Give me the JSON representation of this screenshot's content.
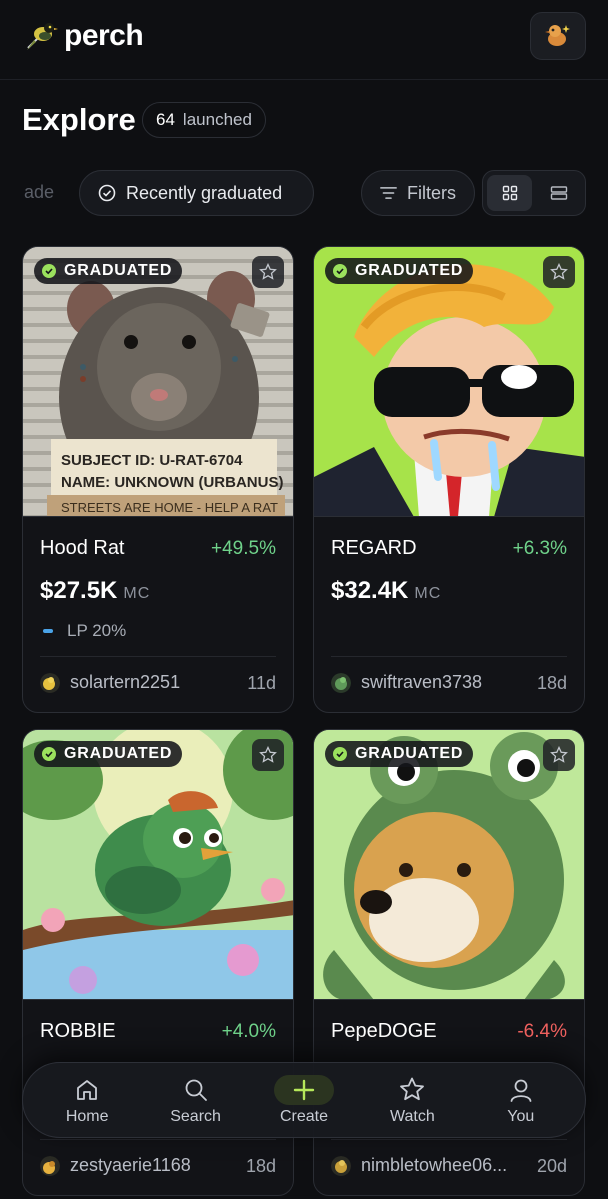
{
  "app": {
    "name": "perch"
  },
  "page": {
    "title": "Explore",
    "launched_count": "64",
    "launched_label": "launched"
  },
  "filters": {
    "faded_chip": "ade",
    "active_chip": "Recently graduated",
    "filters_label": "Filters",
    "view_mode": "grid"
  },
  "cards": [
    {
      "badge": "GRADUATED",
      "name": "Hood Rat",
      "change": "+49.5%",
      "mc": "$27.5K",
      "mc_unit": "MC",
      "lp": "LP 20%",
      "creator": "solartern2251",
      "age": "11d",
      "image_text": [
        "SUBJECT ID: U-RAT-6704",
        "NAME: UNKNOWN (URBANUS)",
        "STREETS ARE HOME - HELP A RAT"
      ]
    },
    {
      "badge": "GRADUATED",
      "name": "REGARD",
      "change": "+6.3%",
      "mc": "$32.4K",
      "mc_unit": "MC",
      "creator": "swiftraven3738",
      "age": "18d"
    },
    {
      "badge": "GRADUATED",
      "name": "ROBBIE",
      "change": "+4.0%",
      "creator": "zestyaerie1168",
      "age": "18d"
    },
    {
      "badge": "GRADUATED",
      "name": "PepeDOGE",
      "change": "-6.4%",
      "creator": "nimbletowhee06...",
      "age": "20d"
    }
  ],
  "nav": {
    "home": "Home",
    "search": "Search",
    "create": "Create",
    "watch": "Watch",
    "you": "You"
  },
  "colors": {
    "accent_green": "#9be15d",
    "positive": "#6fd28a",
    "negative": "#f0615f",
    "background": "#0e0f12"
  }
}
